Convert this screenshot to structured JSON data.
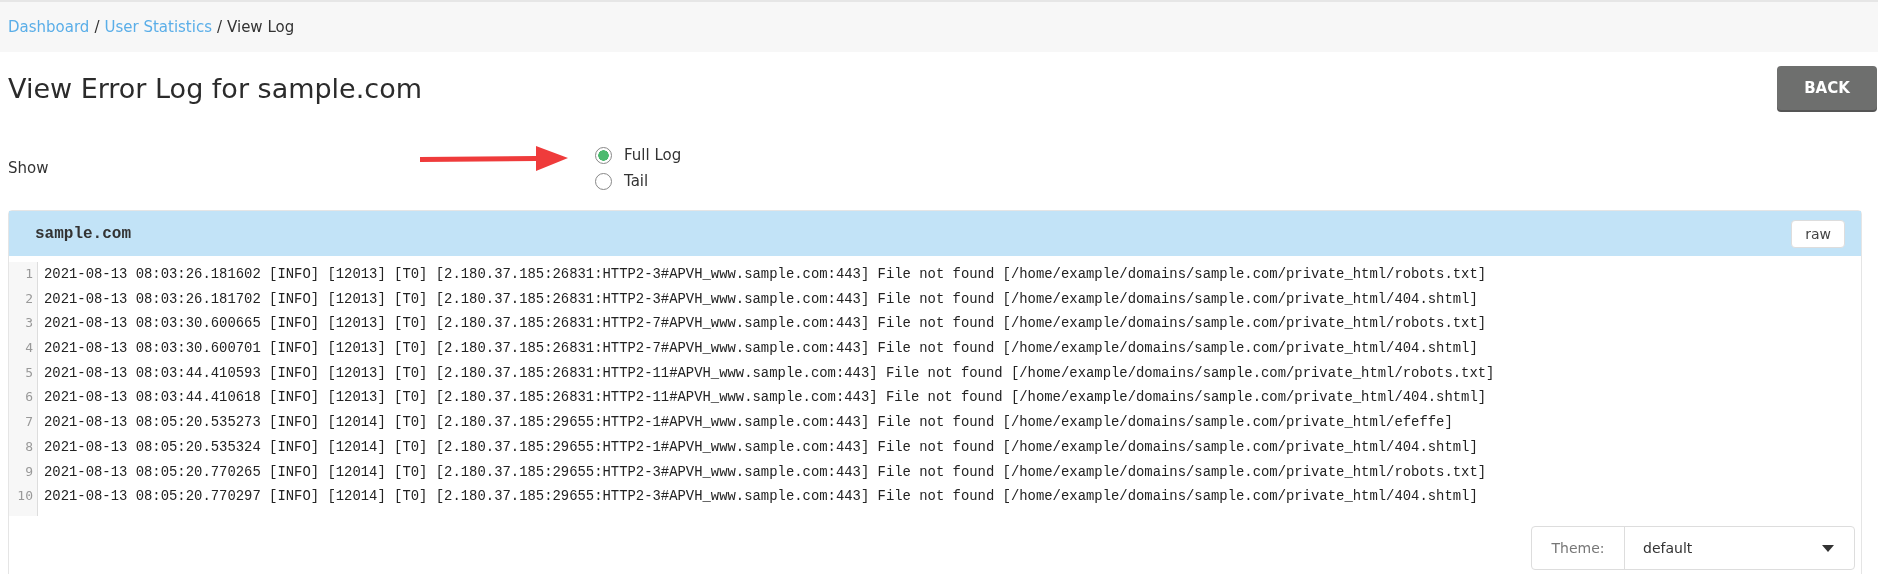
{
  "breadcrumb": [
    {
      "kind": "link",
      "label": "Dashboard"
    },
    {
      "kind": "separator",
      "label": "/"
    },
    {
      "kind": "link",
      "label": "User Statistics"
    },
    {
      "kind": "separator",
      "label": "/"
    },
    {
      "kind": "current",
      "label": "View Log"
    }
  ],
  "title": "View Error Log for sample.com",
  "back_button": "BACK",
  "show": {
    "label": "Show",
    "options": [
      {
        "label": "Full Log",
        "selected": true
      },
      {
        "label": "Tail",
        "selected": false
      }
    ]
  },
  "panel": {
    "title": "sample.com",
    "raw_button": "raw",
    "lines": [
      {
        "number": "1",
        "text": "2021-08-13 08:03:26.181602 [INFO] [12013] [T0] [2.180.37.185:26831:HTTP2-3#APVH_www.sample.com:443] File not found [/home/example/domains/sample.com/private_html/robots.txt]"
      },
      {
        "number": "2",
        "text": "2021-08-13 08:03:26.181702 [INFO] [12013] [T0] [2.180.37.185:26831:HTTP2-3#APVH_www.sample.com:443] File not found [/home/example/domains/sample.com/private_html/404.shtml]"
      },
      {
        "number": "3",
        "text": "2021-08-13 08:03:30.600665 [INFO] [12013] [T0] [2.180.37.185:26831:HTTP2-7#APVH_www.sample.com:443] File not found [/home/example/domains/sample.com/private_html/robots.txt]"
      },
      {
        "number": "4",
        "text": "2021-08-13 08:03:30.600701 [INFO] [12013] [T0] [2.180.37.185:26831:HTTP2-7#APVH_www.sample.com:443] File not found [/home/example/domains/sample.com/private_html/404.shtml]"
      },
      {
        "number": "5",
        "text": "2021-08-13 08:03:44.410593 [INFO] [12013] [T0] [2.180.37.185:26831:HTTP2-11#APVH_www.sample.com:443] File not found [/home/example/domains/sample.com/private_html/robots.txt]"
      },
      {
        "number": "6",
        "text": "2021-08-13 08:03:44.410618 [INFO] [12013] [T0] [2.180.37.185:26831:HTTP2-11#APVH_www.sample.com:443] File not found [/home/example/domains/sample.com/private_html/404.shtml]"
      },
      {
        "number": "7",
        "text": "2021-08-13 08:05:20.535273 [INFO] [12014] [T0] [2.180.37.185:29655:HTTP2-1#APVH_www.sample.com:443] File not found [/home/example/domains/sample.com/private_html/efeffe]"
      },
      {
        "number": "8",
        "text": "2021-08-13 08:05:20.535324 [INFO] [12014] [T0] [2.180.37.185:29655:HTTP2-1#APVH_www.sample.com:443] File not found [/home/example/domains/sample.com/private_html/404.shtml]"
      },
      {
        "number": "9",
        "text": "2021-08-13 08:05:20.770265 [INFO] [12014] [T0] [2.180.37.185:29655:HTTP2-3#APVH_www.sample.com:443] File not found [/home/example/domains/sample.com/private_html/robots.txt]"
      },
      {
        "number": "10",
        "text": "2021-08-13 08:05:20.770297 [INFO] [12014] [T0] [2.180.37.185:29655:HTTP2-3#APVH_www.sample.com:443] File not found [/home/example/domains/sample.com/private_html/404.shtml]"
      }
    ],
    "theme": {
      "label": "Theme:",
      "value": "default"
    }
  }
}
